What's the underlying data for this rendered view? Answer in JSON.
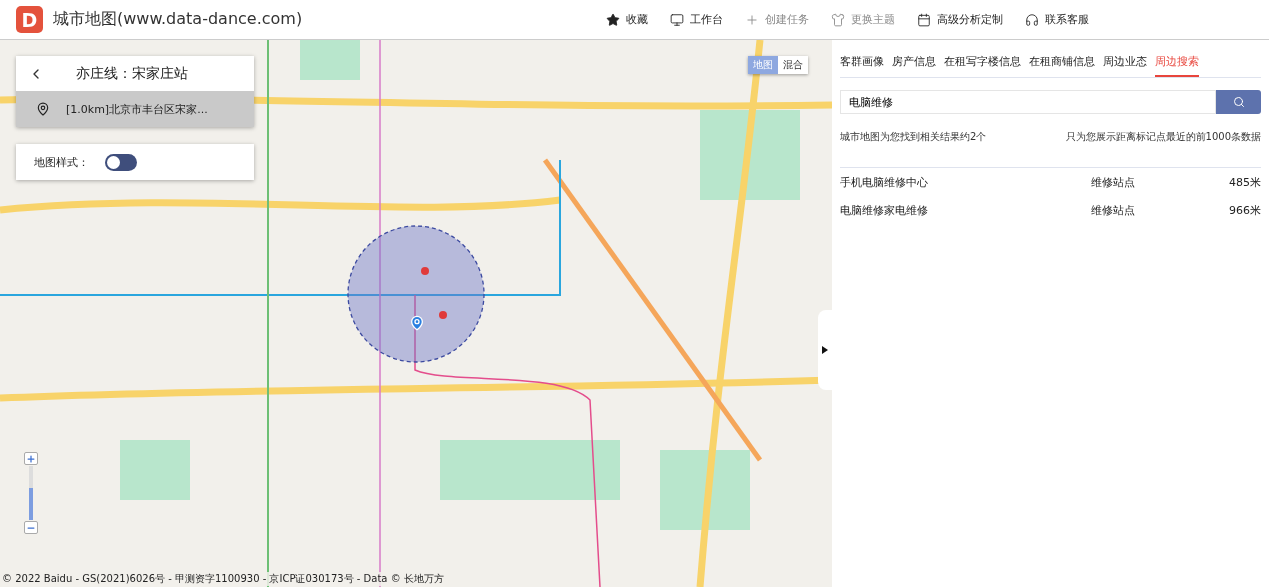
{
  "header": {
    "logo": "D",
    "title": "城市地图(www.data-dance.com)",
    "nav": [
      {
        "kind": "star",
        "label": "收藏",
        "disabled": false
      },
      {
        "kind": "monitor",
        "label": "工作台",
        "disabled": false
      },
      {
        "kind": "plus",
        "label": "创建任务",
        "disabled": true
      },
      {
        "kind": "shirt",
        "label": "更换主题",
        "disabled": true
      },
      {
        "kind": "calendar",
        "label": "高级分析定制",
        "disabled": false
      },
      {
        "kind": "headset",
        "label": "联系客服",
        "disabled": false
      }
    ]
  },
  "map": {
    "station_panel": {
      "title": "亦庄线：宋家庄站",
      "address": "[1.0km]北京市丰台区宋家..."
    },
    "style_panel": {
      "label": "地图样式：",
      "on": false
    },
    "map_types": [
      {
        "label": "地图",
        "selected": true
      },
      {
        "label": "混合",
        "selected": false
      }
    ],
    "zoom": {
      "level": 0.6
    },
    "copyright": "© 2022 Baidu - GS(2021)6026号 - 甲测资字1100930 - 京ICP证030173号 - Data © 长地万方"
  },
  "sidebar": {
    "tabs": [
      {
        "label": "客群画像",
        "selected": false
      },
      {
        "label": "房产信息",
        "selected": false
      },
      {
        "label": "在租写字楼信息",
        "selected": false
      },
      {
        "label": "在租商铺信息",
        "selected": false
      },
      {
        "label": "周边业态",
        "selected": false
      },
      {
        "label": "周边搜索",
        "selected": true
      }
    ],
    "search": {
      "value": "电脑维修"
    },
    "summary": "城市地图为您找到相关结果约2个",
    "note": "只为您展示距离标记点最近的前1000条数据",
    "results": [
      {
        "name": "手机电脑维修中心",
        "category": "维修站点",
        "distance": "485米"
      },
      {
        "name": "电脑维修家电维修",
        "category": "维修站点",
        "distance": "966米"
      }
    ]
  }
}
